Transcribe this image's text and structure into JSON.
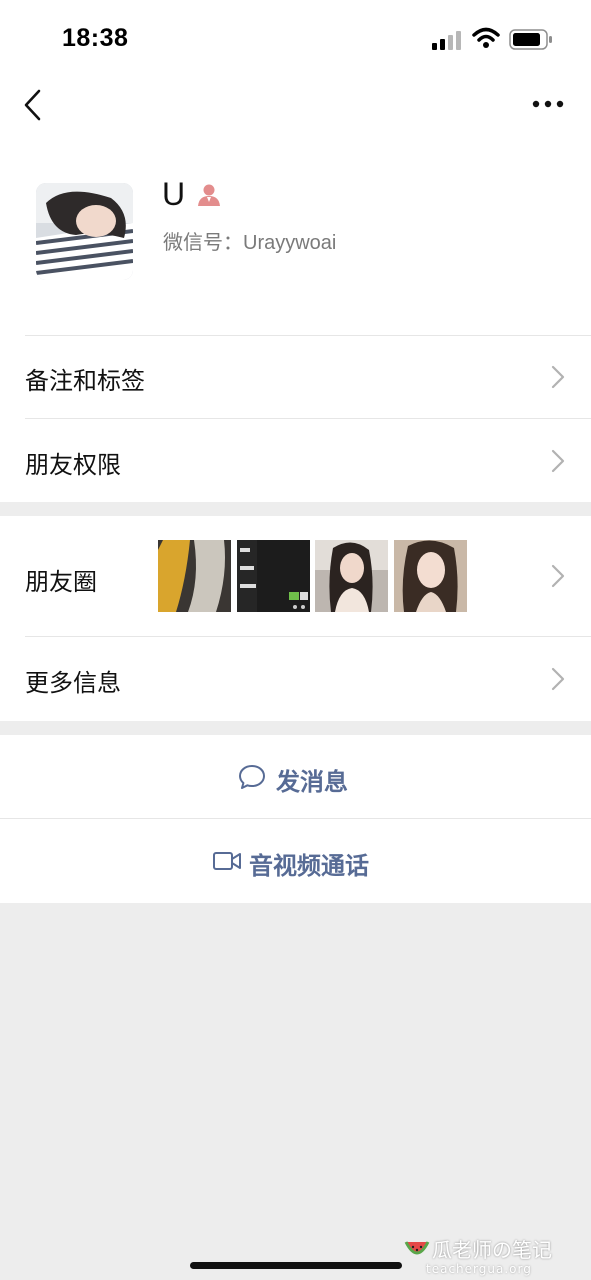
{
  "status_bar": {
    "time": "18:38"
  },
  "nav": {
    "back_icon": "chevron-left-icon",
    "more_icon": "ellipsis-icon"
  },
  "profile": {
    "name": "U",
    "gender_icon": "female-user-icon",
    "gender_color": "#e38d8d",
    "wechat_id": "微信号：Urayywoai"
  },
  "settings": [
    {
      "label": "备注和标签"
    },
    {
      "label": "朋友权限"
    }
  ],
  "info": {
    "moments_label": "朋友圈",
    "more_info_label": "更多信息"
  },
  "actions": {
    "send_message": "发消息",
    "video_call": "音视频通话",
    "link_color": "#576b95"
  },
  "watermark": {
    "title": "瓜老师の笔记",
    "site": "teachergua.org"
  }
}
